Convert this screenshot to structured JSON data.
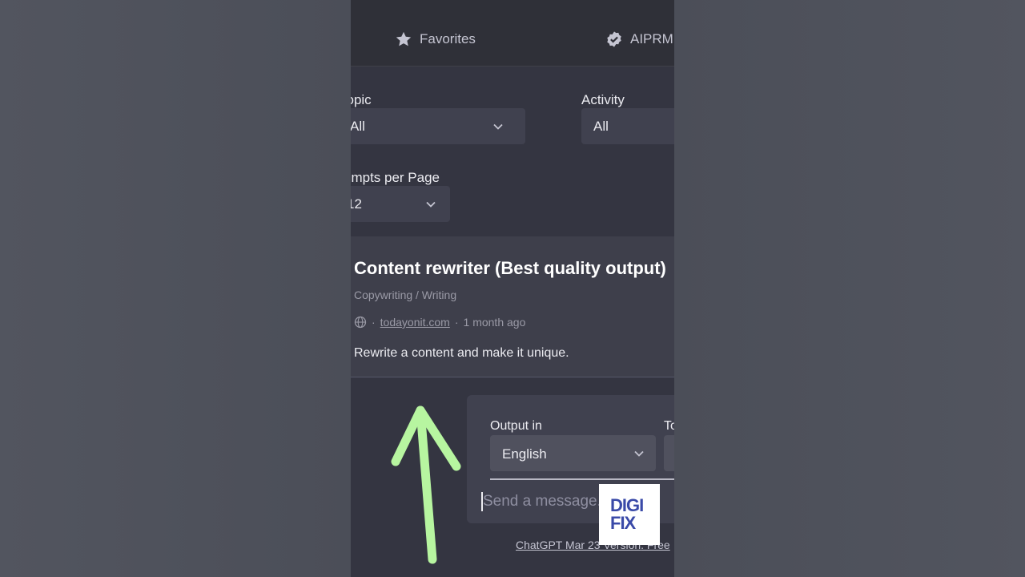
{
  "tabs": {
    "favorites": "Favorites",
    "aiprm": "AIPRM"
  },
  "filters": {
    "topic_label": "Topic",
    "topic_value": "All",
    "activity_label": "Activity",
    "activity_value": "All",
    "per_page_label": "Prompts per Page",
    "per_page_value": "12"
  },
  "prompt_card": {
    "title": "Content rewriter (Best quality output)",
    "category": "Copywriting / Writing",
    "author_link": "todayonit.com",
    "separator": "·",
    "age": "1 month ago",
    "description": "Rewrite a content and make it unique."
  },
  "composer": {
    "output_label": "Output in",
    "output_value": "English",
    "tone_label": "Tone",
    "placeholder": "Send a message..."
  },
  "footer": {
    "version_link": "ChatGPT Mar 23 Version",
    "suffix": ". Free"
  },
  "logo": {
    "line1": "DIGI",
    "line2": "FIX"
  },
  "colors": {
    "page_bg": "#343541",
    "card_bg": "#3e3f4b",
    "input_bg": "#40414f",
    "arrow": "#b7f5a0"
  }
}
